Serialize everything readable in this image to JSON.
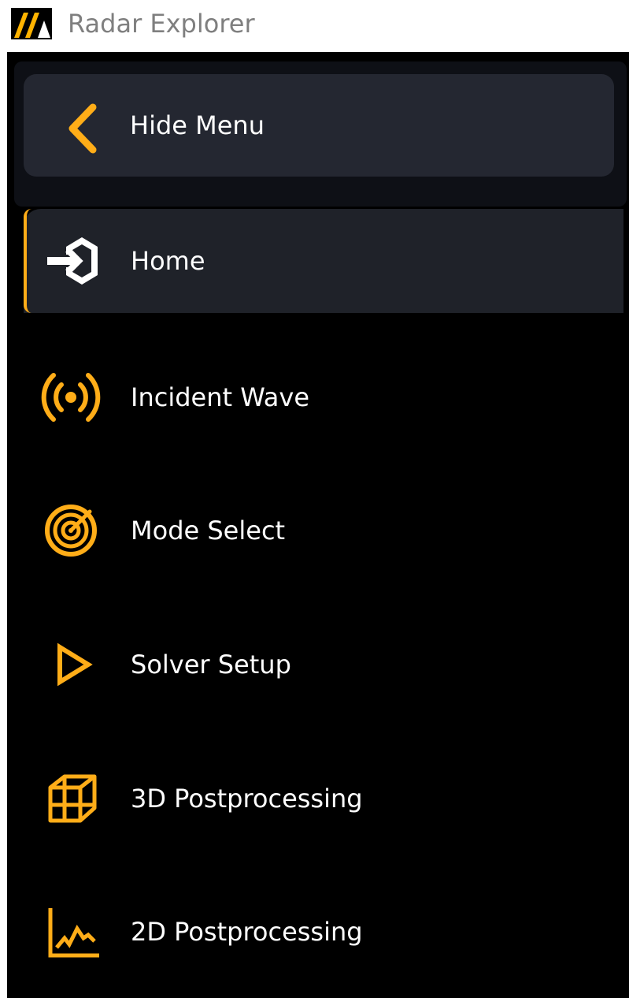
{
  "window": {
    "title": "Radar Explorer",
    "logo_icon": "ansys-logo-icon"
  },
  "menu": {
    "hide_label": "Hide Menu",
    "hide_icon": "chevron-left-icon",
    "accent_color": "#ffad18",
    "active_item": "Home",
    "items": [
      {
        "label": "Home",
        "icon": "sign-in-icon",
        "active": true
      },
      {
        "label": "Incident Wave",
        "icon": "broadcast-icon",
        "active": false
      },
      {
        "label": "Mode Select",
        "icon": "radar-icon",
        "active": false
      },
      {
        "label": "Solver Setup",
        "icon": "play-triangle-icon",
        "active": false
      },
      {
        "label": "3D Postprocessing",
        "icon": "cube-wireframe-icon",
        "active": false
      },
      {
        "label": "2D Postprocessing",
        "icon": "line-chart-icon",
        "active": false
      }
    ]
  },
  "colors": {
    "panel_background": "#000000",
    "active_item_background": "#1f2229",
    "hide_button_background": "#242731",
    "text": "#ffffff",
    "title_text": "#7f7f7f"
  }
}
